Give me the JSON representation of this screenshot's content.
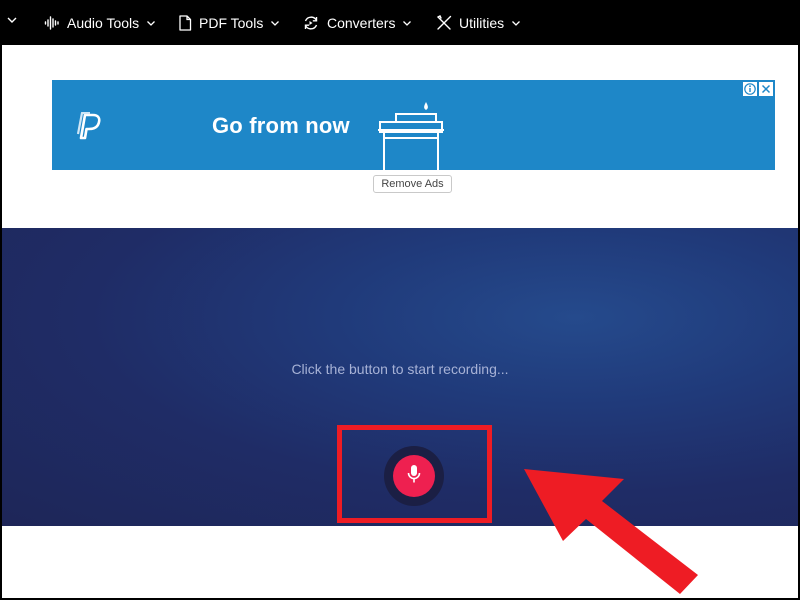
{
  "navbar": {
    "items": [
      {
        "label": "Audio Tools",
        "icon": "audio-wave-icon"
      },
      {
        "label": "PDF Tools",
        "icon": "document-icon"
      },
      {
        "label": "Converters",
        "icon": "refresh-convert-icon"
      },
      {
        "label": "Utilities",
        "icon": "tools-icon"
      }
    ]
  },
  "ad": {
    "headline": "Go from now",
    "logo": "paypal-logo",
    "background_color": "#1e87c8"
  },
  "remove_ads_label": "Remove Ads",
  "recorder": {
    "prompt": "Click the button to start recording...",
    "record_button_icon": "microphone-icon",
    "record_button_color": "#ee2050"
  },
  "annotation": {
    "highlight_color": "#ee1c24"
  }
}
